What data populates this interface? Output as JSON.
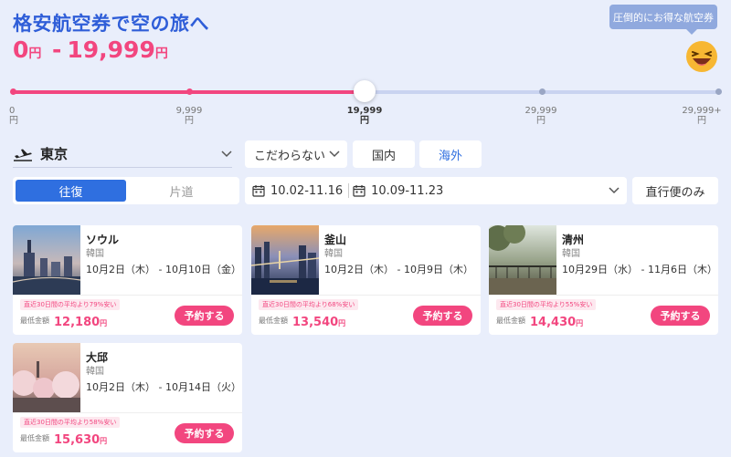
{
  "header": {
    "title": "格安航空券で空の旅へ",
    "price_min": "0",
    "price_max": "19,999",
    "currency": "円",
    "tooltip": "圧倒的にお得な航空券"
  },
  "slider": {
    "selected_max_fraction": 0.5,
    "ticks": [
      {
        "value": "0",
        "unit": "円"
      },
      {
        "value": "9,999",
        "unit": "円"
      },
      {
        "value": "19,999",
        "unit": "円"
      },
      {
        "value": "29,999",
        "unit": "円"
      },
      {
        "value": "29,999+",
        "unit": "円"
      }
    ]
  },
  "filters": {
    "origin": "東京",
    "any_label": "こだわらない",
    "domestic": "国内",
    "international": "海外",
    "round_trip": "往復",
    "one_way": "片道",
    "depart_range": "10.02-11.16",
    "return_range": "10.09-11.23",
    "nonstop": "直行便のみ"
  },
  "cards": [
    {
      "city": "ソウル",
      "country": "韓国",
      "dates": "10月2日（木） - 10月10日（金）",
      "badge": "直近30日間の平均より79%安い",
      "min_label": "最低金額",
      "price": "12,180",
      "yen": "円",
      "book": "予約する"
    },
    {
      "city": "釜山",
      "country": "韓国",
      "dates": "10月2日（木） - 10月9日（木）",
      "badge": "直近30日間の平均より68%安い",
      "min_label": "最低金額",
      "price": "13,540",
      "yen": "円",
      "book": "予約する"
    },
    {
      "city": "清州",
      "country": "韓国",
      "dates": "10月29日（水） - 11月6日（木）",
      "badge": "直近30日間の平均より55%安い",
      "min_label": "最低金額",
      "price": "14,430",
      "yen": "円",
      "book": "予約する"
    },
    {
      "city": "大邱",
      "country": "韓国",
      "dates": "10月2日（木） - 10月14日（火）",
      "badge": "直近30日間の平均より58%安い",
      "min_label": "最低金額",
      "price": "15,630",
      "yen": "円",
      "book": "予約する"
    }
  ],
  "colors": {
    "accent": "#2f6fe0",
    "pink": "#f2467f",
    "background": "#e9eefb"
  },
  "icons": [
    "plane-icon",
    "chevron-down-icon",
    "calendar-icon",
    "laughing-emoji-icon"
  ]
}
